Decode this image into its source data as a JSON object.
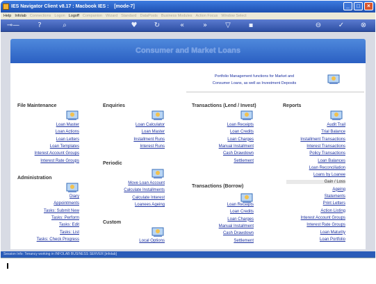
{
  "window": {
    "title": "IES Navigator Client v8.17 : Macbook IES :",
    "mode": "[mode-7]"
  },
  "menu": {
    "help": "Help",
    "infolab": "Infolab",
    "connections": "Connections",
    "logon": "Logon",
    "logoff": "Logoff",
    "companion": "Companion",
    "wizard": "Wizard",
    "standard": "Standard",
    "dataposts": "DataPosts",
    "business_modules": "Business Modules",
    "action_focus": "Action Focus",
    "window_select": "Window Select"
  },
  "toolbar": {
    "icons": [
      "key-icon",
      "help-icon",
      "search-icon",
      "heart-icon",
      "refresh-icon",
      "back-icon",
      "forward-icon",
      "filter-icon",
      "save-icon",
      "delete-icon",
      "ok-icon",
      "close-icon"
    ]
  },
  "banner": {
    "title": "Consumer and Market Loans"
  },
  "description": {
    "line1": "Portfolio Management functions for Market and",
    "line2": "Consumer Loans, as well as Investment Deposits"
  },
  "file_maintenance": {
    "title": "File Maintenance",
    "items": [
      "Loan Master",
      "Loan Actions",
      "Loan Letters",
      "Loan Templates",
      "Interest Account Groups",
      "Interest Rate Groups"
    ]
  },
  "administration": {
    "title": "Administration",
    "items": [
      "Diary",
      "Appointments",
      "Tasks: Submit New",
      "Tasks: Perform",
      "Tasks: Edit",
      "Tasks: List",
      "Tasks: Check Progress"
    ]
  },
  "enquiries": {
    "title": "Enquiries",
    "items": [
      "Loan Calculator",
      "Loan Master",
      "Installment Runs",
      "Interest Runs"
    ]
  },
  "periodic": {
    "title": "Periodic",
    "items": [
      "Move Loan Account",
      "Calculate Installments",
      "Calculate Interest",
      "Loanees Ageing"
    ]
  },
  "custom": {
    "title": "Custom",
    "items": [
      "Local Options"
    ]
  },
  "transactions_lend": {
    "title": "Transactions (Lend / Invest)",
    "items": [
      "Loan Receipts",
      "Loan Credits",
      "Loan Charges",
      "Manual Installment",
      "Cash Drawdown",
      "Settlement"
    ]
  },
  "transactions_borrow": {
    "title": "Transactions (Borrow)",
    "items": [
      "Loan Receipts",
      "Loan Credits",
      "Loan Charges",
      "Manual Installment",
      "Cash Drawdown",
      "Settlement"
    ]
  },
  "reports": {
    "title": "Reports",
    "items": [
      "Audit Trail",
      "Trial Balance",
      "Installment Transactions",
      "Interest Transactions",
      "Policy Transactions",
      "Loan Balances",
      "Loan Reconciliation",
      "Loans by Loanee",
      "Gain / Loss",
      "Ageing",
      "Statements",
      "Print Letters",
      "Action Listing",
      "Interest Account Groups",
      "Interest Rate Groups",
      "Loan Maturity",
      "Loan Portfolio"
    ]
  },
  "status": {
    "text": "Session Info: Tenancy working in INFOLAB BUSINESS SERVER  [infolab]"
  }
}
